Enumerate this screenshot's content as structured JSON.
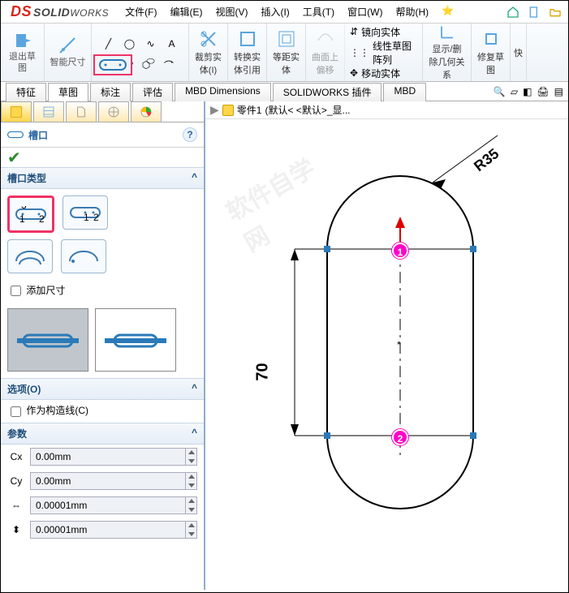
{
  "app": {
    "title": "SOLIDWORKS"
  },
  "menu": {
    "file": "文件(F)",
    "edit": "编辑(E)",
    "view": "视图(V)",
    "insert": "插入(I)",
    "tools": "工具(T)",
    "window": "窗口(W)",
    "help": "帮助(H)"
  },
  "ribbon": {
    "exit_sketch": "退出草图",
    "smart_dim": "智能尺寸",
    "trim": "裁剪实体(I)",
    "convert": "转换实体引用",
    "offset": "等距实体",
    "surface_offset": "曲面上偏移",
    "mirror": "镜向实体",
    "linear_pattern": "线性草图阵列",
    "move": "移动实体",
    "show_rel": "显示/删除几何关系",
    "repair": "修复草图",
    "quick": "快"
  },
  "tabs": {
    "feature": "特征",
    "sketch": "草图",
    "annotate": "标注",
    "evaluate": "评估",
    "mbd": "MBD Dimensions",
    "addins": "SOLIDWORKS 插件",
    "mbdtab": "MBD"
  },
  "pm": {
    "title": "槽口",
    "type_header": "槽口类型",
    "add_dim": "添加尺寸",
    "options_header": "选项(O)",
    "construction": "作为构造线(C)",
    "params_header": "参数",
    "cx": "0.00mm",
    "cy": "0.00mm",
    "len": "0.00001mm",
    "wid": "0.00001mm"
  },
  "crumb": {
    "part": "零件1",
    "state": "(默认< <默认>_显..."
  },
  "dims": {
    "height": "70",
    "radius": "R35"
  },
  "points": {
    "p1": "1",
    "p2": "2"
  },
  "chart_data": {
    "type": "diagram",
    "slot": {
      "length": 70,
      "radius": 35,
      "width": 70
    },
    "points": [
      {
        "id": 1,
        "role": "start-center",
        "x": 0,
        "y": 0
      },
      {
        "id": 2,
        "role": "end-center",
        "x": 0,
        "y": -70
      }
    ]
  }
}
